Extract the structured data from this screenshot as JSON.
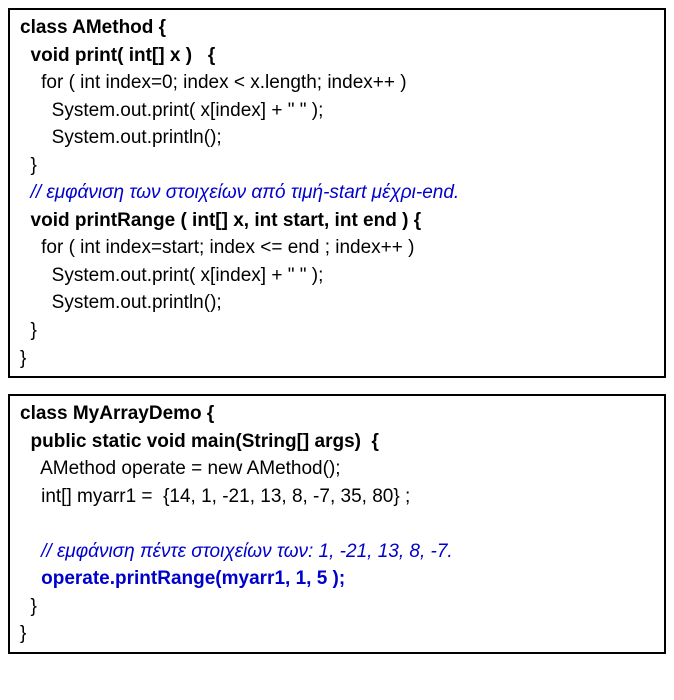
{
  "box1": {
    "l1": "class AMethod {",
    "l2": "  void print( int[] x )   {",
    "l3": "    for ( int index=0; index < x.length; index++ )",
    "l4": "      System.out.print( x[index] + \" \" );",
    "l5": "      System.out.println();",
    "l6": "  }",
    "l7": "  // εμφάνιση των στοιχείων από τιμή-start μέχρι-end.",
    "l8": "  void printRange ( int[] x, int start, int end ) {",
    "l9": "    for ( int index=start; index <= end ; index++ )",
    "l10": "      System.out.print( x[index] + \" \" );",
    "l11": "      System.out.println();",
    "l12": "  }",
    "l13": "}"
  },
  "box2": {
    "l1": "class MyArrayDemo {",
    "l2": "  public static void main(String[] args)  {",
    "l3": "    AMethod operate = new AMethod();",
    "l4": "    int[] myarr1 =  {14, 1, -21, 13, 8, -7, 35, 80} ;",
    "l5": " ",
    "l6": "    // εμφάνιση πέντε στοιχείων των: 1, -21, 13, 8, -7.",
    "l7": "    operate.printRange(myarr1, 1, 5 );",
    "l8": "  }",
    "l9": "}"
  }
}
